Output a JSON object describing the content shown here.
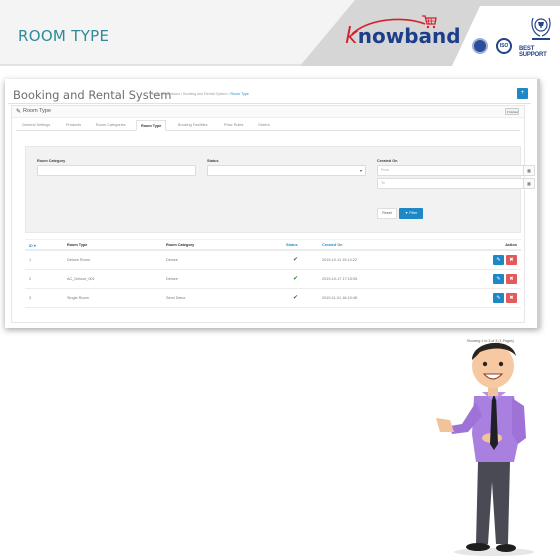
{
  "banner": {
    "title": "ROOM TYPE",
    "brand_logo": "Knowband",
    "brand_logo_initial": "k",
    "brand_logo_rest": "nowband",
    "badges": [
      "certification-seal",
      "ISO"
    ],
    "iso_label": "ISO",
    "support_label": "BEST SUPPORT",
    "colors": {
      "title": "#2e8a98",
      "logo_blue": "#1d3f8a",
      "logo_red": "#d3202f"
    }
  },
  "admin": {
    "page_title": "Booking and Rental System",
    "breadcrumb": [
      "Home",
      "Extensions",
      "Booking and Rental System",
      "Room Type"
    ],
    "add_button_icon": "plus-icon",
    "add_button_label": "+",
    "panel_title": "Room Type",
    "panel_icon": "pencil-icon",
    "language_select": "Default",
    "tabs": [
      {
        "label": "General Settings",
        "active": false
      },
      {
        "label": "Products",
        "active": false
      },
      {
        "label": "Room Categories",
        "active": false
      },
      {
        "label": "Room Type",
        "active": true
      },
      {
        "label": "Booking Facilities",
        "active": false
      },
      {
        "label": "Price Rules",
        "active": false
      },
      {
        "label": "Orders",
        "active": false
      }
    ],
    "filter": {
      "room_category_label": "Room Category",
      "room_category_value": "",
      "status_label": "Status",
      "status_value": "",
      "created_on_label": "Created On",
      "from_placeholder": "From",
      "to_placeholder": "To",
      "reset_label": "Reset",
      "filter_label": "Filter"
    },
    "table": {
      "columns": [
        "ID",
        "Room Type",
        "Room Category",
        "Status",
        "Created On",
        "Action"
      ],
      "rows": [
        {
          "id": "1",
          "room_type": "Deluxe Room",
          "room_category": "Deluxe",
          "status": "enabled",
          "created_on": "2019-10-11 19:14:22"
        },
        {
          "id": "2",
          "room_type": "AC_Deluxe_001",
          "room_category": "Deluxe",
          "status": "enabled",
          "created_on": "2019-10-17 17:15:05"
        },
        {
          "id": "3",
          "room_type": "Single Room",
          "room_category": "Semi Delux",
          "status": "enabled",
          "created_on": "2019-11-01 16:15:48"
        }
      ],
      "check_glyph": "✔",
      "edit_glyph": "✎",
      "delete_glyph": "✖",
      "pagination": "Showing 1 to 3 of 3 (1 Pages)"
    },
    "colors": {
      "primary": "#1e88c7",
      "danger": "#e35a5a",
      "status_ok": "#2f7d32"
    }
  },
  "illustration": {
    "subject": "cartoon businessman in purple shirt presenting"
  }
}
